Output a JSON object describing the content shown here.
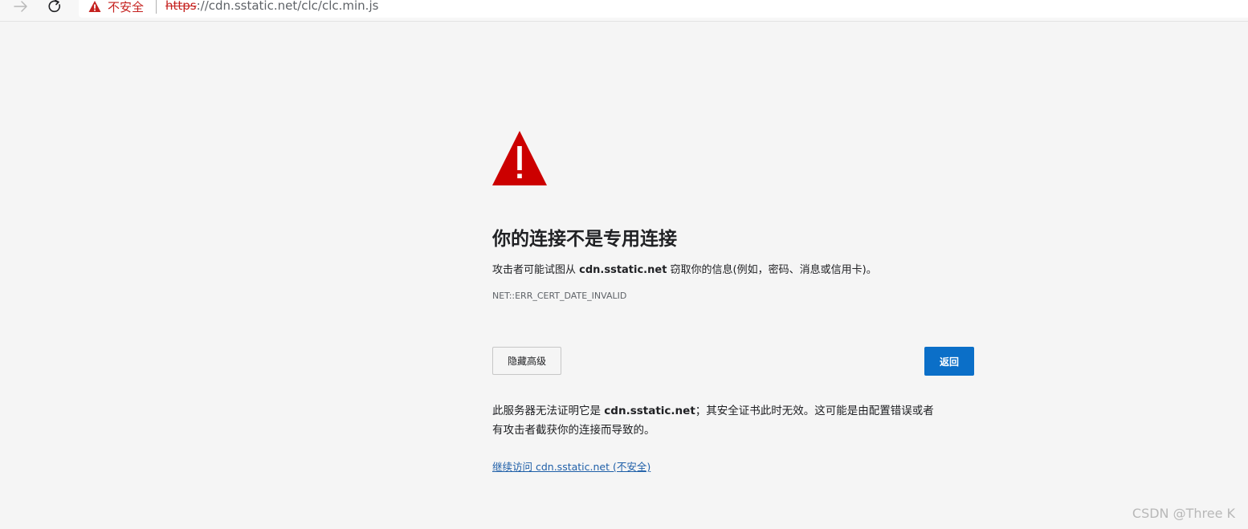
{
  "browser": {
    "nav": {
      "forward_icon": "arrow-right-icon",
      "reload_icon": "reload-icon"
    },
    "address_bar": {
      "security_icon": "warning-triangle-icon",
      "security_label": "不安全",
      "url_scheme": "https",
      "url_rest": "://cdn.sstatic.net/clc/clc.min.js",
      "security_color": "#c5221f"
    }
  },
  "interstitial": {
    "icon": "warning-triangle-icon",
    "icon_color": "#cc0000",
    "title": "你的连接不是专用连接",
    "intro_before": "攻击者可能试图从 ",
    "intro_host": "cdn.sstatic.net",
    "intro_after": " 窃取你的信息(例如，密码、消息或信用卡)。",
    "error_code": "NET::ERR_CERT_DATE_INVALID",
    "advanced_button": "隐藏高级",
    "back_button": "返回",
    "back_button_color": "#0b6fc8",
    "details_line1_before": "此服务器无法证明它是 ",
    "details_host": "cdn.sstatic.net",
    "details_line1_after": "；其安全证书此时无效。这可能是由配置错误或者",
    "details_line2": "有攻击者截获你的连接而导致的。",
    "proceed_link": "继续访问 cdn.sstatic.net (不安全)",
    "link_color": "#1f5fa8"
  },
  "watermark": "CSDN @Three K"
}
